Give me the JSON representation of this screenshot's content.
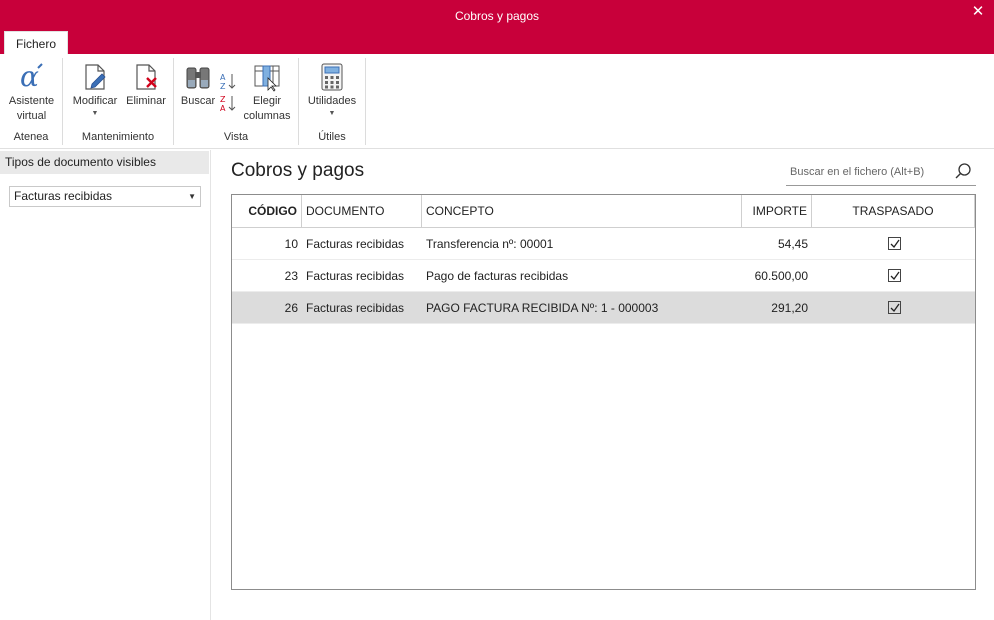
{
  "window": {
    "title": "Cobros y pagos",
    "close_glyph": "✕"
  },
  "ribbon": {
    "tab": "Fichero",
    "groups": {
      "atenea": {
        "label": "Atenea",
        "btn_asistente": [
          "Asistente",
          "virtual"
        ]
      },
      "mantenimiento": {
        "label": "Mantenimiento",
        "btn_modificar": "Modificar",
        "btn_eliminar": "Eliminar"
      },
      "vista": {
        "label": "Vista",
        "btn_buscar": "Buscar",
        "btn_elegir": [
          "Elegir",
          "columnas"
        ]
      },
      "utiles": {
        "label": "Útiles",
        "btn_utilidades": "Utilidades"
      }
    }
  },
  "left_panel": {
    "header": "Tipos de documento visibles",
    "select_value": "Facturas recibidas"
  },
  "main": {
    "title": "Cobros y pagos",
    "search_placeholder": "Buscar en el fichero (Alt+B)",
    "columns": [
      "CÓDIGO",
      "DOCUMENTO",
      "CONCEPTO",
      "IMPORTE",
      "TRASPASADO"
    ],
    "rows": [
      {
        "codigo": "10",
        "documento": "Facturas recibidas",
        "concepto": "Transferencia nº: 00001",
        "importe": "54,45",
        "traspasado": true
      },
      {
        "codigo": "23",
        "documento": "Facturas recibidas",
        "concepto": "Pago de facturas recibidas",
        "importe": "60.500,00",
        "traspasado": true
      },
      {
        "codigo": "26",
        "documento": "Facturas recibidas",
        "concepto": "PAGO FACTURA RECIBIDA Nº: 1 - 000003",
        "importe": "291,20",
        "traspasado": true,
        "selected": true
      }
    ]
  },
  "colors": {
    "titlebar": "#c8003a",
    "selected_row": "#dcdcdc"
  }
}
